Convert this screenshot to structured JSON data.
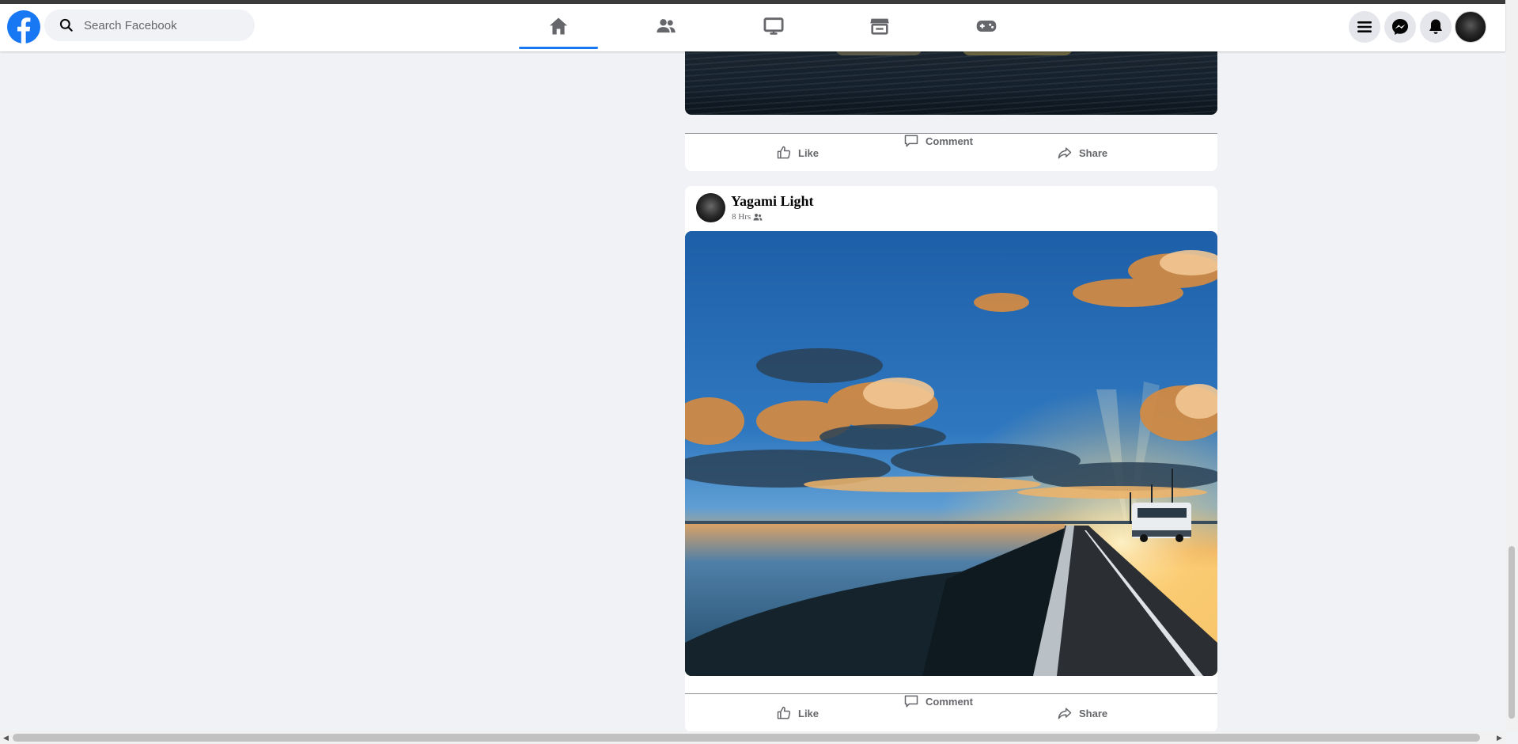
{
  "search": {
    "placeholder": "Search Facebook"
  },
  "nav": {
    "tabs": [
      {
        "name": "home",
        "icon": "home-icon",
        "active": true
      },
      {
        "name": "friends",
        "icon": "friends-icon",
        "active": false
      },
      {
        "name": "watch",
        "icon": "watch-icon",
        "active": false
      },
      {
        "name": "marketplace",
        "icon": "marketplace-icon",
        "active": false
      },
      {
        "name": "gaming",
        "icon": "gaming-icon",
        "active": false
      }
    ],
    "right_icons": [
      "menu-icon",
      "messenger-icon",
      "bell-icon",
      "avatar"
    ]
  },
  "posts": [
    {
      "actions": {
        "like": "Like",
        "comment": "Comment",
        "share": "Share"
      }
    },
    {
      "author": "Yagami Light",
      "time": "8 Hrs",
      "audience_icon": "friends-icon",
      "actions": {
        "like": "Like",
        "comment": "Comment",
        "share": "Share"
      }
    }
  ],
  "colors": {
    "brand": "#1877f2",
    "background": "#f0f2f5",
    "icon_gray": "#65676b"
  }
}
